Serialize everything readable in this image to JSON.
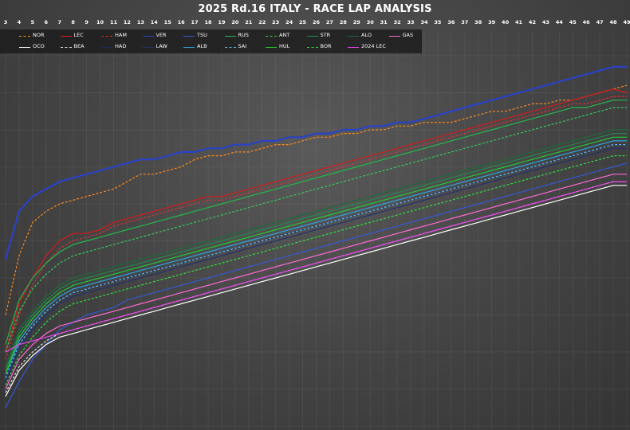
{
  "title": "2025 Rd.16 ITALY - RACE LAP ANALYSIS",
  "chart_data": {
    "type": "line",
    "title": "2025 Rd.16 ITALY - RACE LAP ANALYSIS",
    "xlabel": "",
    "ylabel": "",
    "laps": [
      3,
      4,
      5,
      6,
      7,
      8,
      9,
      10,
      11,
      12,
      13,
      14,
      15,
      16,
      17,
      18,
      19,
      20,
      21,
      22,
      23,
      24,
      25,
      26,
      27,
      28,
      29,
      30,
      31,
      32,
      33,
      34,
      35,
      36,
      37,
      38,
      39,
      40,
      41,
      42,
      43,
      44,
      45,
      46,
      47,
      48,
      49
    ],
    "grid": true,
    "legend_position": "top-left",
    "series": [
      {
        "name": "NOR",
        "color": "#ff8a1c",
        "dash": "3,2",
        "values": [
          0.3,
          0.46,
          0.55,
          0.58,
          0.6,
          0.61,
          0.62,
          0.63,
          0.64,
          0.66,
          0.68,
          0.68,
          0.69,
          0.7,
          0.72,
          0.73,
          0.73,
          0.74,
          0.74,
          0.75,
          0.76,
          0.76,
          0.77,
          0.78,
          0.78,
          0.79,
          0.79,
          0.8,
          0.8,
          0.81,
          0.81,
          0.82,
          0.82,
          0.82,
          0.83,
          0.84,
          0.85,
          0.85,
          0.86,
          0.87,
          0.87,
          0.88,
          0.88,
          0.89,
          0.9,
          0.91,
          0.92
        ]
      },
      {
        "name": "LEC",
        "color": "#d91a1a",
        "dash": "",
        "values": [
          0.2,
          0.33,
          0.4,
          0.46,
          0.5,
          0.52,
          0.52,
          0.53,
          0.55,
          0.56,
          0.57,
          0.58,
          0.59,
          0.6,
          0.61,
          0.62,
          0.62,
          0.63,
          0.64,
          0.65,
          0.66,
          0.67,
          0.68,
          0.69,
          0.7,
          0.71,
          0.72,
          0.73,
          0.74,
          0.75,
          0.76,
          0.77,
          0.78,
          0.79,
          0.8,
          0.81,
          0.82,
          0.83,
          0.84,
          0.85,
          0.86,
          0.87,
          0.88,
          0.89,
          0.9,
          0.91,
          0.9
        ]
      },
      {
        "name": "HAM",
        "color": "#d93030",
        "dash": "3,2",
        "values": [
          0.18,
          0.3,
          0.38,
          0.44,
          0.48,
          0.5,
          0.51,
          0.52,
          0.54,
          0.55,
          0.56,
          0.57,
          0.58,
          0.59,
          0.6,
          0.61,
          0.61,
          0.62,
          0.63,
          0.64,
          0.65,
          0.66,
          0.67,
          0.68,
          0.69,
          0.7,
          0.71,
          0.72,
          0.73,
          0.74,
          0.75,
          0.76,
          0.77,
          0.78,
          0.79,
          0.8,
          0.81,
          0.82,
          0.83,
          0.84,
          0.85,
          0.86,
          0.87,
          0.87,
          0.88,
          0.89,
          0.89
        ]
      },
      {
        "name": "VER",
        "color": "#2942c8",
        "dash": "",
        "values": [
          0.45,
          0.58,
          0.62,
          0.64,
          0.66,
          0.67,
          0.68,
          0.69,
          0.7,
          0.71,
          0.72,
          0.72,
          0.73,
          0.74,
          0.74,
          0.75,
          0.75,
          0.76,
          0.76,
          0.77,
          0.77,
          0.78,
          0.78,
          0.79,
          0.79,
          0.8,
          0.8,
          0.81,
          0.81,
          0.82,
          0.82,
          0.83,
          0.84,
          0.85,
          0.86,
          0.87,
          0.88,
          0.89,
          0.9,
          0.91,
          0.92,
          0.93,
          0.94,
          0.95,
          0.96,
          0.97,
          0.97
        ]
      },
      {
        "name": "TSU",
        "color": "#3558d8",
        "dash": "",
        "values": [
          0.05,
          0.12,
          0.18,
          0.22,
          0.26,
          0.28,
          0.3,
          0.31,
          0.32,
          0.34,
          0.35,
          0.36,
          0.37,
          0.38,
          0.39,
          0.4,
          0.41,
          0.42,
          0.43,
          0.44,
          0.45,
          0.46,
          0.47,
          0.48,
          0.49,
          0.5,
          0.51,
          0.52,
          0.53,
          0.54,
          0.55,
          0.56,
          0.57,
          0.58,
          0.59,
          0.6,
          0.61,
          0.62,
          0.63,
          0.64,
          0.65,
          0.66,
          0.67,
          0.68,
          0.69,
          0.7,
          0.71
        ]
      },
      {
        "name": "RUS",
        "color": "#26b84a",
        "dash": "",
        "values": [
          0.22,
          0.34,
          0.4,
          0.44,
          0.47,
          0.49,
          0.5,
          0.51,
          0.52,
          0.53,
          0.54,
          0.55,
          0.56,
          0.57,
          0.58,
          0.59,
          0.6,
          0.61,
          0.62,
          0.63,
          0.64,
          0.65,
          0.66,
          0.67,
          0.68,
          0.69,
          0.7,
          0.71,
          0.72,
          0.73,
          0.74,
          0.75,
          0.76,
          0.77,
          0.78,
          0.79,
          0.8,
          0.81,
          0.82,
          0.83,
          0.84,
          0.85,
          0.86,
          0.86,
          0.87,
          0.88,
          0.88
        ]
      },
      {
        "name": "ANT",
        "color": "#39c860",
        "dash": "3,2",
        "values": [
          0.2,
          0.31,
          0.37,
          0.41,
          0.44,
          0.46,
          0.47,
          0.48,
          0.49,
          0.5,
          0.51,
          0.52,
          0.53,
          0.54,
          0.55,
          0.56,
          0.57,
          0.58,
          0.59,
          0.6,
          0.61,
          0.62,
          0.63,
          0.64,
          0.65,
          0.66,
          0.67,
          0.68,
          0.69,
          0.7,
          0.71,
          0.72,
          0.73,
          0.74,
          0.75,
          0.76,
          0.77,
          0.78,
          0.79,
          0.8,
          0.81,
          0.82,
          0.83,
          0.84,
          0.85,
          0.86,
          0.86
        ]
      },
      {
        "name": "STR",
        "color": "#1f8c4a",
        "dash": "",
        "values": [
          0.15,
          0.25,
          0.3,
          0.34,
          0.37,
          0.39,
          0.4,
          0.41,
          0.42,
          0.43,
          0.44,
          0.45,
          0.46,
          0.47,
          0.48,
          0.49,
          0.5,
          0.51,
          0.52,
          0.53,
          0.54,
          0.55,
          0.56,
          0.57,
          0.58,
          0.59,
          0.6,
          0.61,
          0.62,
          0.63,
          0.64,
          0.65,
          0.66,
          0.67,
          0.68,
          0.69,
          0.7,
          0.71,
          0.72,
          0.73,
          0.74,
          0.75,
          0.76,
          0.77,
          0.78,
          0.79,
          0.79
        ]
      },
      {
        "name": "ALO",
        "color": "#1a6b3a",
        "dash": "",
        "values": [
          0.16,
          0.26,
          0.31,
          0.35,
          0.38,
          0.4,
          0.41,
          0.42,
          0.43,
          0.44,
          0.45,
          0.46,
          0.47,
          0.48,
          0.49,
          0.5,
          0.51,
          0.52,
          0.53,
          0.54,
          0.55,
          0.56,
          0.57,
          0.58,
          0.59,
          0.6,
          0.61,
          0.62,
          0.63,
          0.64,
          0.65,
          0.66,
          0.67,
          0.68,
          0.69,
          0.7,
          0.71,
          0.72,
          0.73,
          0.74,
          0.75,
          0.76,
          0.77,
          0.78,
          0.79,
          0.8,
          0.8
        ]
      },
      {
        "name": "GAS",
        "color": "#ff6ad5",
        "dash": "",
        "values": [
          0.1,
          0.18,
          0.22,
          0.25,
          0.27,
          0.28,
          0.29,
          0.3,
          0.31,
          0.32,
          0.33,
          0.34,
          0.35,
          0.36,
          0.37,
          0.38,
          0.39,
          0.4,
          0.41,
          0.42,
          0.43,
          0.44,
          0.45,
          0.46,
          0.47,
          0.48,
          0.49,
          0.5,
          0.51,
          0.52,
          0.53,
          0.54,
          0.55,
          0.56,
          0.57,
          0.58,
          0.59,
          0.6,
          0.61,
          0.62,
          0.63,
          0.64,
          0.65,
          0.66,
          0.67,
          0.68,
          0.68
        ]
      },
      {
        "name": "OCO",
        "color": "#ffffff",
        "dash": "",
        "values": [
          0.08,
          0.15,
          0.19,
          0.22,
          0.24,
          0.25,
          0.26,
          0.27,
          0.28,
          0.29,
          0.3,
          0.31,
          0.32,
          0.33,
          0.34,
          0.35,
          0.36,
          0.37,
          0.38,
          0.39,
          0.4,
          0.41,
          0.42,
          0.43,
          0.44,
          0.45,
          0.46,
          0.47,
          0.48,
          0.49,
          0.5,
          0.51,
          0.52,
          0.53,
          0.54,
          0.55,
          0.56,
          0.57,
          0.58,
          0.59,
          0.6,
          0.61,
          0.62,
          0.63,
          0.64,
          0.65,
          0.65
        ]
      },
      {
        "name": "BEA",
        "color": "#e0e0e0",
        "dash": "3,2",
        "values": [
          0.09,
          0.16,
          0.2,
          0.23,
          0.25,
          0.26,
          0.27,
          0.28,
          0.29,
          0.3,
          0.31,
          0.32,
          0.33,
          0.34,
          0.35,
          0.36,
          0.37,
          0.38,
          0.39,
          0.4,
          0.41,
          0.42,
          0.43,
          0.44,
          0.45,
          0.46,
          0.47,
          0.48,
          0.49,
          0.5,
          0.51,
          0.52,
          0.53,
          0.54,
          0.55,
          0.56,
          0.57,
          0.58,
          0.59,
          0.6,
          0.61,
          0.62,
          0.63,
          0.64,
          0.65,
          0.66,
          0.66
        ]
      },
      {
        "name": "HAD",
        "color": "#1c2a66",
        "dash": "",
        "values": [
          0.13,
          0.22,
          0.27,
          0.31,
          0.34,
          0.36,
          0.37,
          0.38,
          0.39,
          0.4,
          0.41,
          0.42,
          0.43,
          0.44,
          0.45,
          0.46,
          0.47,
          0.48,
          0.49,
          0.5,
          0.51,
          0.52,
          0.53,
          0.54,
          0.55,
          0.56,
          0.57,
          0.58,
          0.59,
          0.6,
          0.61,
          0.62,
          0.63,
          0.64,
          0.65,
          0.66,
          0.67,
          0.68,
          0.69,
          0.7,
          0.71,
          0.72,
          0.73,
          0.74,
          0.75,
          0.76,
          0.76
        ]
      },
      {
        "name": "LAW",
        "color": "#23306e",
        "dash": "",
        "values": [
          0.12,
          0.21,
          0.26,
          0.3,
          0.33,
          0.35,
          0.36,
          0.37,
          0.38,
          0.39,
          0.4,
          0.41,
          0.42,
          0.43,
          0.44,
          0.45,
          0.46,
          0.47,
          0.48,
          0.49,
          0.5,
          0.51,
          0.52,
          0.53,
          0.54,
          0.55,
          0.56,
          0.57,
          0.58,
          0.59,
          0.6,
          0.61,
          0.62,
          0.63,
          0.64,
          0.65,
          0.66,
          0.67,
          0.68,
          0.69,
          0.7,
          0.71,
          0.72,
          0.73,
          0.74,
          0.75,
          0.75
        ]
      },
      {
        "name": "ALB",
        "color": "#2ea3e0",
        "dash": "",
        "values": [
          0.14,
          0.23,
          0.28,
          0.32,
          0.35,
          0.37,
          0.38,
          0.39,
          0.4,
          0.41,
          0.42,
          0.43,
          0.44,
          0.45,
          0.46,
          0.47,
          0.48,
          0.49,
          0.5,
          0.51,
          0.52,
          0.53,
          0.54,
          0.55,
          0.56,
          0.57,
          0.58,
          0.59,
          0.6,
          0.61,
          0.62,
          0.63,
          0.64,
          0.65,
          0.66,
          0.67,
          0.68,
          0.69,
          0.7,
          0.71,
          0.72,
          0.73,
          0.74,
          0.75,
          0.76,
          0.77,
          0.77
        ]
      },
      {
        "name": "SAI",
        "color": "#5fc0f0",
        "dash": "3,2",
        "values": [
          0.13,
          0.22,
          0.27,
          0.31,
          0.34,
          0.36,
          0.37,
          0.38,
          0.39,
          0.4,
          0.41,
          0.42,
          0.43,
          0.44,
          0.45,
          0.46,
          0.47,
          0.48,
          0.49,
          0.5,
          0.51,
          0.52,
          0.53,
          0.54,
          0.55,
          0.56,
          0.57,
          0.58,
          0.59,
          0.6,
          0.61,
          0.62,
          0.63,
          0.64,
          0.65,
          0.66,
          0.67,
          0.68,
          0.69,
          0.7,
          0.71,
          0.72,
          0.73,
          0.74,
          0.75,
          0.76,
          0.76
        ]
      },
      {
        "name": "HUL",
        "color": "#1fcc33",
        "dash": "",
        "values": [
          0.14,
          0.24,
          0.29,
          0.33,
          0.36,
          0.38,
          0.39,
          0.4,
          0.41,
          0.42,
          0.43,
          0.44,
          0.45,
          0.46,
          0.47,
          0.48,
          0.49,
          0.5,
          0.51,
          0.52,
          0.53,
          0.54,
          0.55,
          0.56,
          0.57,
          0.58,
          0.59,
          0.6,
          0.61,
          0.62,
          0.63,
          0.64,
          0.65,
          0.66,
          0.67,
          0.68,
          0.69,
          0.7,
          0.71,
          0.72,
          0.73,
          0.74,
          0.75,
          0.76,
          0.77,
          0.78,
          0.78
        ]
      },
      {
        "name": "BOR",
        "color": "#33dd44",
        "dash": "3,2",
        "values": [
          0.11,
          0.19,
          0.24,
          0.28,
          0.31,
          0.33,
          0.34,
          0.35,
          0.36,
          0.37,
          0.38,
          0.39,
          0.4,
          0.41,
          0.42,
          0.43,
          0.44,
          0.45,
          0.46,
          0.47,
          0.48,
          0.49,
          0.5,
          0.51,
          0.52,
          0.53,
          0.54,
          0.55,
          0.56,
          0.57,
          0.58,
          0.59,
          0.6,
          0.61,
          0.62,
          0.63,
          0.64,
          0.65,
          0.66,
          0.67,
          0.68,
          0.69,
          0.7,
          0.71,
          0.72,
          0.73,
          0.73
        ]
      },
      {
        "name": "2024 LEC",
        "color": "#ee44ee",
        "dash": "",
        "values": [
          0.2,
          0.22,
          0.23,
          0.24,
          0.25,
          0.26,
          0.27,
          0.28,
          0.29,
          0.3,
          0.31,
          0.32,
          0.33,
          0.34,
          0.35,
          0.36,
          0.37,
          0.38,
          0.39,
          0.4,
          0.41,
          0.42,
          0.43,
          0.44,
          0.45,
          0.46,
          0.47,
          0.48,
          0.49,
          0.5,
          0.51,
          0.52,
          0.53,
          0.54,
          0.55,
          0.56,
          0.57,
          0.58,
          0.59,
          0.6,
          0.61,
          0.62,
          0.63,
          0.64,
          0.65,
          0.66,
          0.66
        ]
      }
    ]
  }
}
